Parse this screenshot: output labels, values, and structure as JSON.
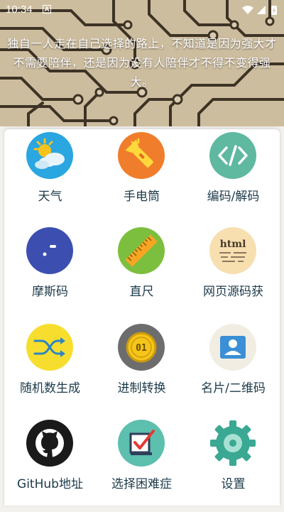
{
  "status_bar": {
    "time": "10:34",
    "icons": [
      "notification-a-icon",
      "wifi-icon",
      "signal-icon",
      "battery-charging-icon"
    ]
  },
  "header": {
    "quote": "独自一人走在自己选择的路上，不知道是因为强大才不需要陪伴，还是因为没有人陪伴才不得不变得强大。"
  },
  "tools": [
    {
      "label": "天气",
      "icon": "weather-icon",
      "color": "#2aa6e0"
    },
    {
      "label": "手电筒",
      "icon": "flashlight-icon",
      "color": "#f07d2b"
    },
    {
      "label": "编码/解码",
      "icon": "code-icon",
      "color": "#5fb8a0"
    },
    {
      "label": "摩斯码",
      "icon": "morse-code-icon",
      "color": "#3c4fb0"
    },
    {
      "label": "直尺",
      "icon": "ruler-icon",
      "color": "#7cbf3e"
    },
    {
      "label": "网页源码获",
      "icon": "html-source-icon",
      "color": "#f7dfb0"
    },
    {
      "label": "随机数生成",
      "icon": "shuffle-icon",
      "color": "#f7de2e"
    },
    {
      "label": "进制转换",
      "icon": "binary-coin-icon",
      "color": "#6d6d6d"
    },
    {
      "label": "名片/二维码",
      "icon": "business-card-icon",
      "color": "#f2ede2"
    },
    {
      "label": "GitHub地址",
      "icon": "github-icon",
      "color": "#1a1a1a"
    },
    {
      "label": "选择困难症",
      "icon": "checkbox-icon",
      "color": "#5dbfae"
    },
    {
      "label": "设置",
      "icon": "settings-gear-icon",
      "color": "#3aa892"
    }
  ]
}
